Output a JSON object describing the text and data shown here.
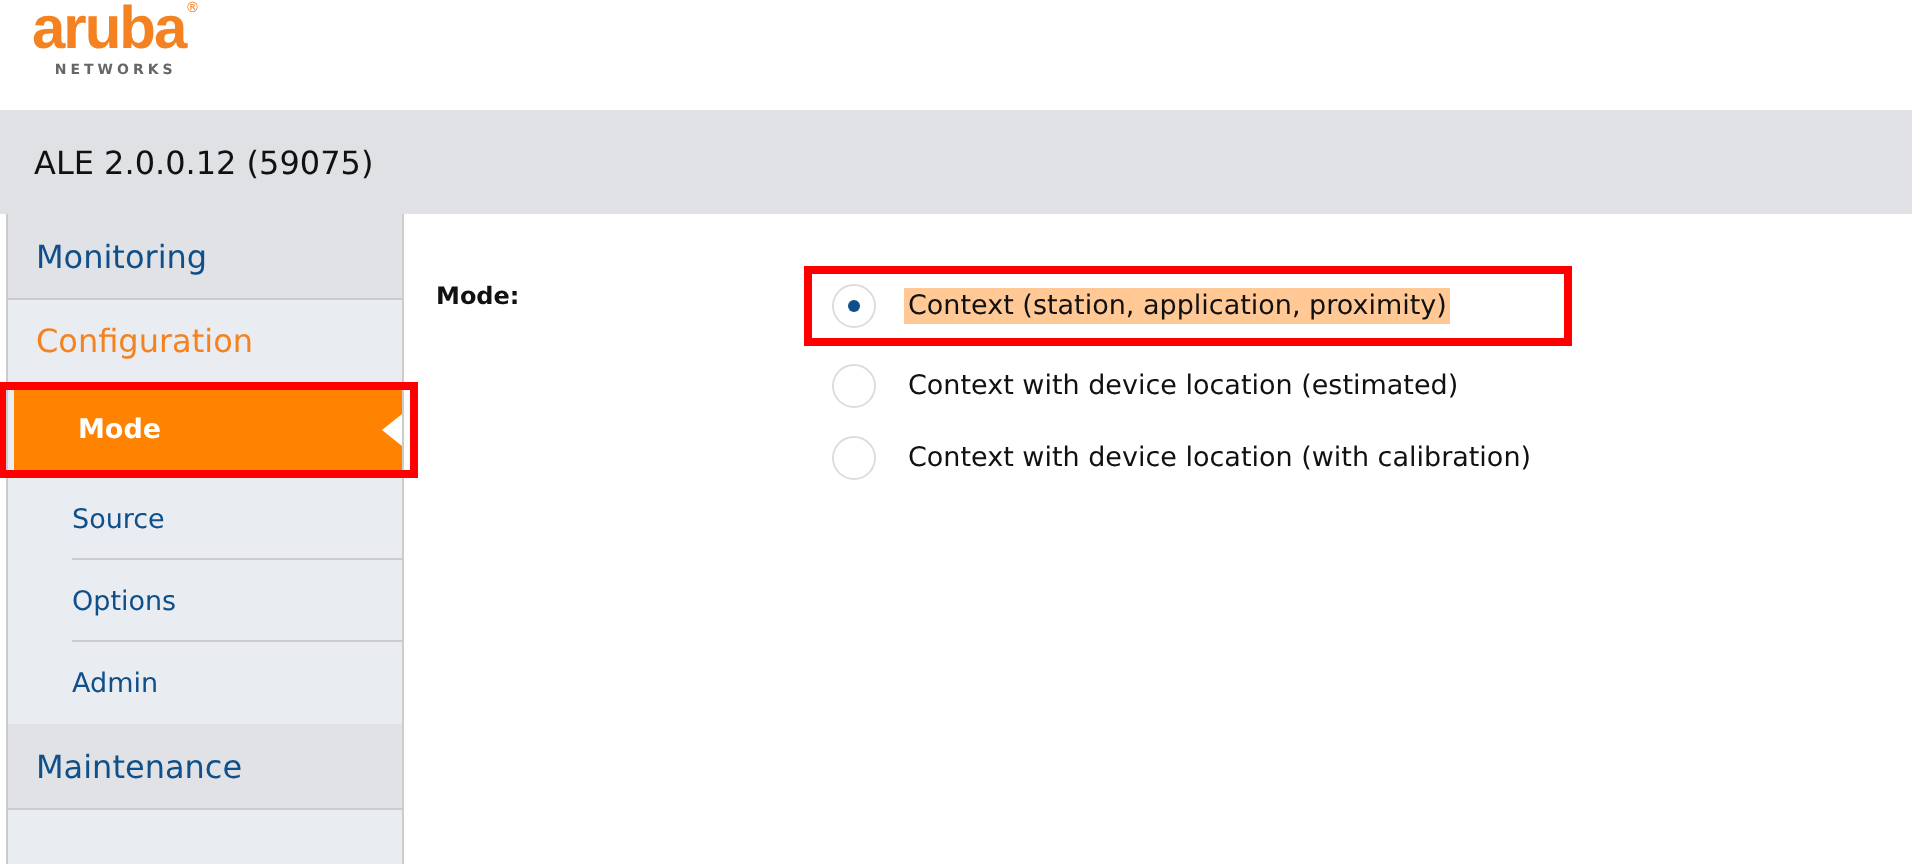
{
  "logo": {
    "name": "aruba",
    "mark": "®",
    "tagline": "NETWORKS"
  },
  "header": {
    "title": "ALE 2.0.0.12 (59075)"
  },
  "sidebar": {
    "sections": [
      {
        "label": "Monitoring",
        "expanded": false
      },
      {
        "label": "Configuration",
        "expanded": true,
        "children": [
          {
            "label": "Mode",
            "selected": true,
            "highlighted": true
          },
          {
            "label": "Source",
            "selected": false,
            "highlighted": false
          },
          {
            "label": "Options",
            "selected": false,
            "highlighted": false
          },
          {
            "label": "Admin",
            "selected": false,
            "highlighted": false
          }
        ]
      },
      {
        "label": "Maintenance",
        "expanded": false
      }
    ]
  },
  "form": {
    "label": "Mode:",
    "options": [
      {
        "label": "Context (station, application, proximity)",
        "selected": true,
        "highlighted": true
      },
      {
        "label": "Context with device location (estimated)",
        "selected": false,
        "highlighted": false
      },
      {
        "label": "Context with device location (with calibration)",
        "selected": false,
        "highlighted": false
      }
    ]
  }
}
